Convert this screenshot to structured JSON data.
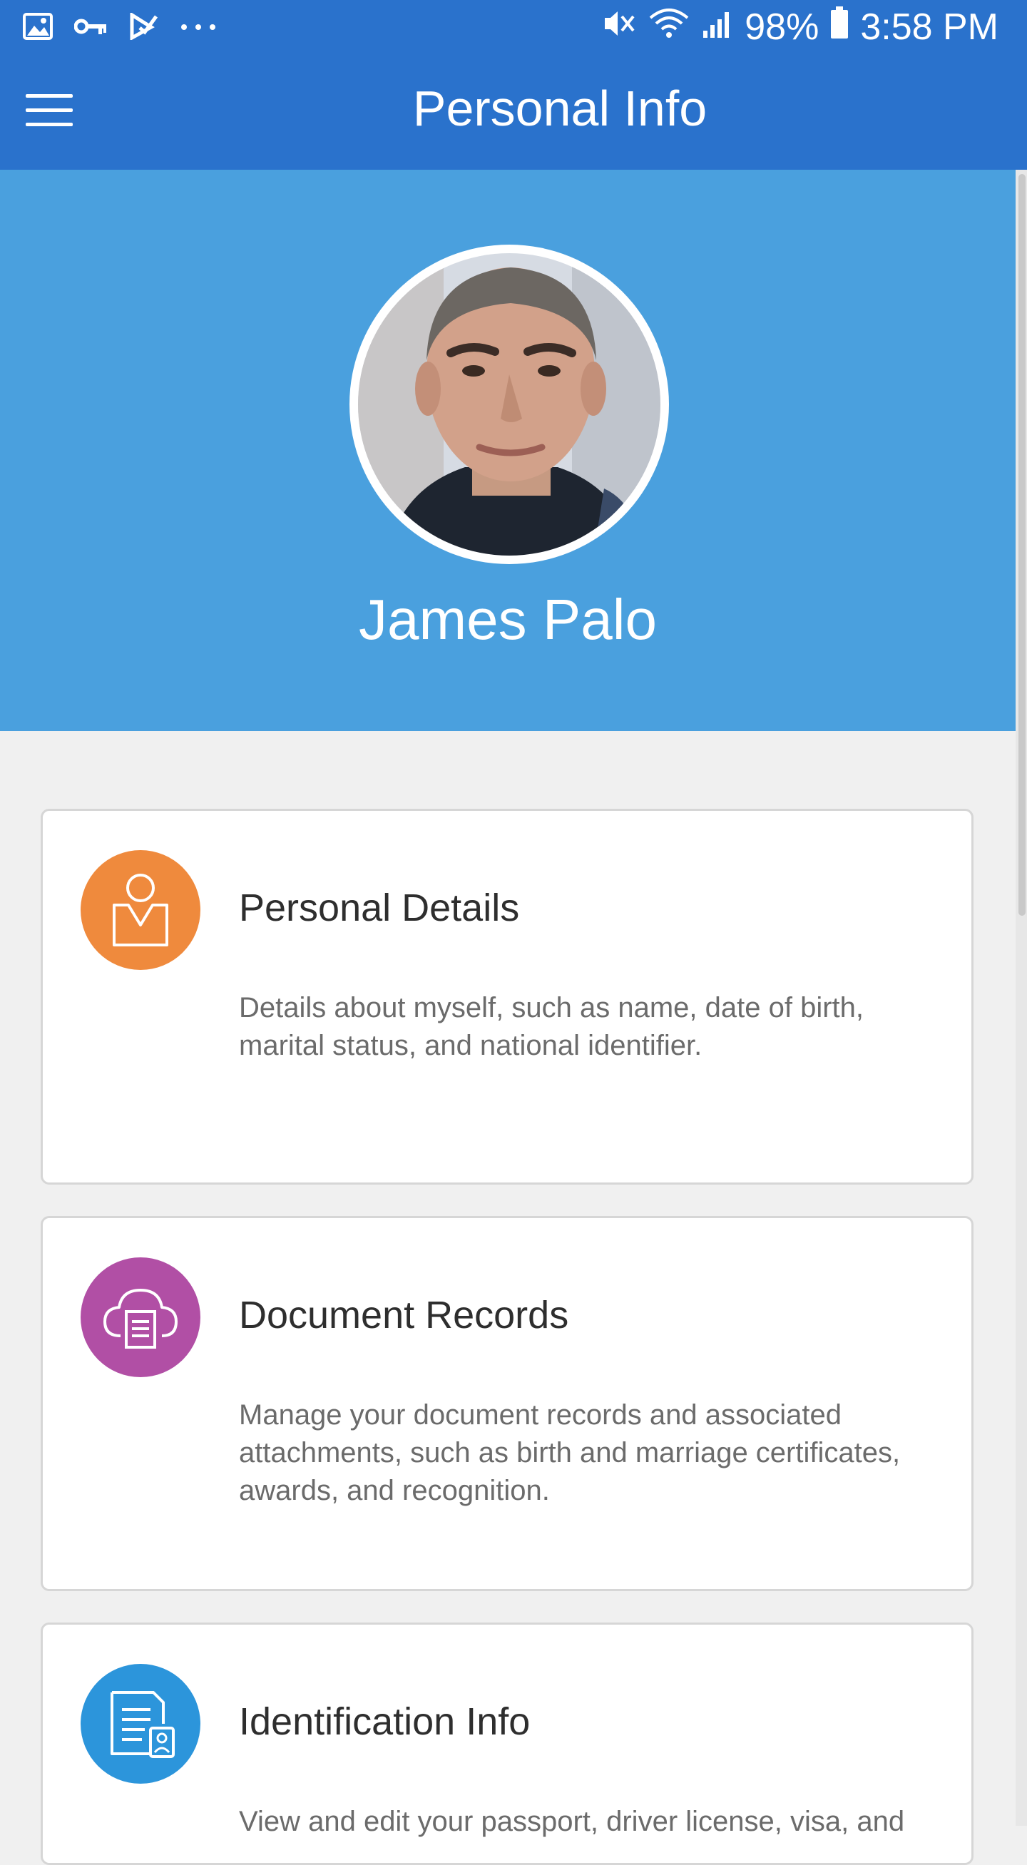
{
  "status_bar": {
    "left_icons": [
      "image-icon",
      "key-icon",
      "check-icon",
      "more-dots-icon"
    ],
    "right_icons": [
      "mute-icon",
      "wifi-icon",
      "signal-icon",
      "battery-icon"
    ],
    "battery": "98%",
    "time": "3:58 PM"
  },
  "app_bar": {
    "title": "Personal Info",
    "menu_icon": "hamburger-menu-icon"
  },
  "profile": {
    "name": "James Palo"
  },
  "cards": [
    {
      "title": "Personal Details",
      "description": "Details about myself, such as name, date of birth, marital status, and national identifier.",
      "icon": "person-icon",
      "icon_color": "#ef8a3d"
    },
    {
      "title": "Document Records",
      "description": "Manage your document records and associated attachments, such as birth and marriage certificates, awards, and recognition.",
      "icon": "cloud-document-icon",
      "icon_color": "#b14fa5"
    },
    {
      "title": "Identification Info",
      "description": "View and edit your passport, driver license, visa, and",
      "icon": "id-document-icon",
      "icon_color": "#2c95db"
    }
  ],
  "colors": {
    "app_bar": "#2a72cc",
    "header": "#4aa0de",
    "background": "#f0f0f0"
  }
}
